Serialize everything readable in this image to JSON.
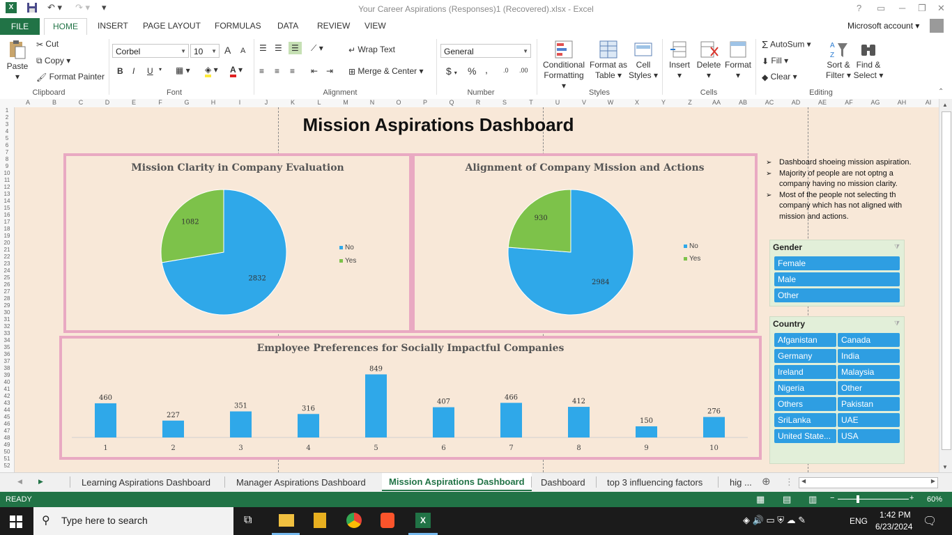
{
  "window": {
    "title": "Your Career Aspirations (Responses)1 (Recovered).xlsx - Excel",
    "help": "?",
    "minimize": "─",
    "restore": "❐",
    "close": "✕"
  },
  "ribbon_tabs": {
    "file": "FILE",
    "home": "HOME",
    "insert": "INSERT",
    "page_layout": "PAGE LAYOUT",
    "formulas": "FORMULAS",
    "data": "DATA",
    "review": "REVIEW",
    "view": "VIEW",
    "account": "Microsoft account"
  },
  "ribbon": {
    "clipboard": {
      "paste": "Paste",
      "cut": "Cut",
      "copy": "Copy",
      "format_painter": "Format Painter",
      "label": "Clipboard"
    },
    "font": {
      "name": "Corbel",
      "size": "10",
      "bold": "B",
      "italic": "I",
      "underline": "U",
      "grow": "A",
      "shrink": "A",
      "label": "Font"
    },
    "alignment": {
      "wrap_text": "Wrap Text",
      "merge_center": "Merge & Center",
      "label": "Alignment"
    },
    "number": {
      "format": "General",
      "currency": "$",
      "percent": "%",
      "comma": ",",
      "inc_decimal": ".0",
      "dec_decimal": ".00",
      "label": "Number"
    },
    "styles": {
      "conditional": "Conditional",
      "conditional2": "Formatting",
      "format_as": "Format as",
      "format_as2": "Table",
      "cell": "Cell",
      "cell2": "Styles",
      "label": "Styles"
    },
    "cells": {
      "insert": "Insert",
      "delete": "Delete",
      "format": "Format",
      "label": "Cells"
    },
    "editing": {
      "autosum": "AutoSum",
      "fill": "Fill",
      "clear": "Clear",
      "sort": "Sort &",
      "sort2": "Filter",
      "find": "Find &",
      "find2": "Select",
      "label": "Editing"
    }
  },
  "columns": [
    "A",
    "B",
    "C",
    "D",
    "E",
    "F",
    "G",
    "H",
    "I",
    "J",
    "K",
    "L",
    "M",
    "N",
    "O",
    "P",
    "Q",
    "R",
    "S",
    "T",
    "U",
    "V",
    "W",
    "X",
    "Y",
    "Z",
    "AA",
    "AB",
    "AC",
    "AD",
    "AE",
    "AF",
    "AG",
    "AH",
    "AI"
  ],
  "rows": [
    "1",
    "2",
    "3",
    "4",
    "5",
    "6",
    "7",
    "8",
    "9",
    "10",
    "11",
    "12",
    "13",
    "14",
    "15",
    "16",
    "17",
    "18",
    "19",
    "20",
    "21",
    "22",
    "23",
    "24",
    "25",
    "26",
    "27",
    "28",
    "29",
    "30",
    "31",
    "32",
    "33",
    "34",
    "35",
    "36",
    "37",
    "38",
    "39",
    "40",
    "41",
    "42",
    "43",
    "44",
    "45",
    "46",
    "47",
    "48",
    "49",
    "50",
    "51",
    "52"
  ],
  "dashboard": {
    "title": "Mission Aspirations Dashboard",
    "notes": [
      "Dashboard shoeing mission aspiration.",
      "Majority of people are not optng a company having no mission clarity.",
      "Most of the people not selecting th company which has not aligned with mission and actions."
    ],
    "notes_arrow": "➢"
  },
  "chart_data": [
    {
      "type": "pie",
      "title": "Mission Clarity in Company Evaluation",
      "categories": [
        "No",
        "Yes"
      ],
      "values": [
        2832,
        1082
      ],
      "colors": [
        "#2fa8e9",
        "#7dc24a"
      ],
      "legend": "right"
    },
    {
      "type": "pie",
      "title": "Alignment of Company Mission and Actions",
      "categories": [
        "No",
        "Yes"
      ],
      "values": [
        2984,
        930
      ],
      "colors": [
        "#2fa8e9",
        "#7dc24a"
      ],
      "legend": "right"
    },
    {
      "type": "bar",
      "title": "Employee Preferences for Socially Impactful Companies",
      "categories": [
        "1",
        "2",
        "3",
        "4",
        "5",
        "6",
        "7",
        "8",
        "9",
        "10"
      ],
      "values": [
        460,
        227,
        351,
        316,
        849,
        407,
        466,
        412,
        150,
        276
      ],
      "color": "#2fa8e9",
      "ylim": [
        0,
        900
      ]
    }
  ],
  "slicers": {
    "gender": {
      "title": "Gender",
      "items": [
        "Female",
        "Male",
        "Other"
      ]
    },
    "country": {
      "title": "Country",
      "items": [
        "Afganistan",
        "Canada",
        "Germany",
        "India",
        "Ireland",
        "Malaysia",
        "Nigeria",
        "Other",
        "Others",
        "Pakistan",
        "SriLanka",
        "UAE",
        "United State...",
        "USA"
      ]
    },
    "filter_icon": "⧩"
  },
  "sheet_tabs": [
    "Learning Aspirations Dashboard",
    "Manager Aspirations Dashboard",
    "Mission Aspirations Dashboard",
    "Dashboard",
    "top 3 influencing factors",
    "hig ..."
  ],
  "status": {
    "ready": "READY",
    "zoom": "60%",
    "zoom_minus": "−",
    "zoom_plus": "+"
  },
  "taskbar": {
    "search_placeholder": "Type here to search",
    "lang": "ENG",
    "time": "1:42 PM",
    "date": "6/23/2024"
  }
}
